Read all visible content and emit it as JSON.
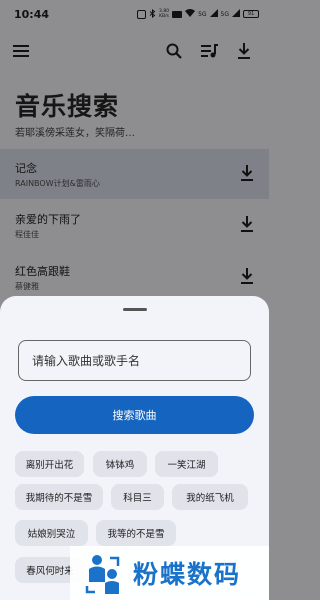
{
  "status": {
    "time": "10:44",
    "speed": "3.80\nKB/s",
    "signal1": "5G",
    "signal2": "5G",
    "battery": "91"
  },
  "app_bar": {
    "icons": [
      "menu-icon",
      "search-icon",
      "playlist-icon",
      "download-icon"
    ]
  },
  "page": {
    "title": "音乐搜索",
    "subtitle": "若耶溪傍采莲女，笑隔荷…"
  },
  "songs": [
    {
      "title": "记念",
      "artist": "RAINBOW计划&雷雨心",
      "highlighted": true
    },
    {
      "title": "亲爱的下雨了",
      "artist": "程佳佳",
      "highlighted": false
    },
    {
      "title": "红色高跟鞋",
      "artist": "蔡健雅",
      "highlighted": false
    }
  ],
  "sheet": {
    "search_placeholder": "请输入歌曲或歌手名",
    "search_value": "",
    "search_button": "搜索歌曲",
    "chips": [
      "离别开出花",
      "钵钵鸡",
      "一笑江湖",
      "我期待的不是雪",
      "科目三",
      "我的纸飞机",
      "姑娘别哭泣",
      "我等的不是雪",
      "春风何时来"
    ]
  },
  "watermark": {
    "text": "粉蝶数码"
  },
  "colors": {
    "accent": "#1565c0",
    "overlay": "#8e8e90",
    "sheet": "#f2f4fa",
    "chip": "#e0e3ea",
    "watermark_text": "#1a73c9"
  }
}
